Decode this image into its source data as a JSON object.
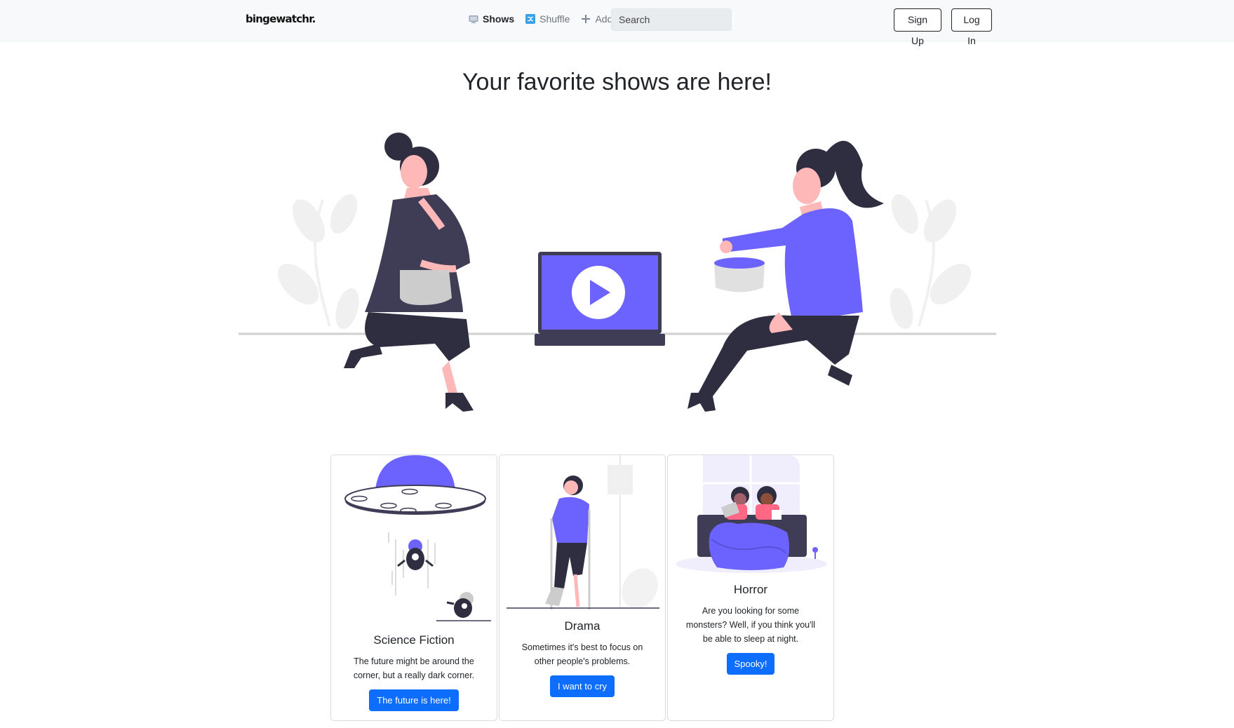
{
  "navbar": {
    "brand": "bingewatchr.",
    "links": [
      {
        "label": "Shows",
        "icon": "tv-icon",
        "active": true
      },
      {
        "label": "Shuffle",
        "icon": "shuffle-icon",
        "active": false
      },
      {
        "label": "Add",
        "icon": "plus-icon",
        "active": false
      }
    ],
    "search_placeholder": "Search",
    "signup_label": "Sign Up",
    "login_label": "Log In"
  },
  "hero": {
    "title": "Your favorite shows are here!"
  },
  "cards": [
    {
      "title": "Science Fiction",
      "text": "The future might be around the corner, but a really dark corner.",
      "button": "The future is here!"
    },
    {
      "title": "Drama",
      "text": "Sometimes it's best to focus on other people's problems.",
      "button": "I want to cry"
    },
    {
      "title": "Horror",
      "text": "Are you looking for some monsters? Well, if you think you'll be able to sleep at night.",
      "button": "Spooky!"
    }
  ],
  "colors": {
    "accent": "#6c63ff",
    "dark": "#3f3d56",
    "skin": "#ffb8b8",
    "primary_button": "#0d6efd"
  }
}
